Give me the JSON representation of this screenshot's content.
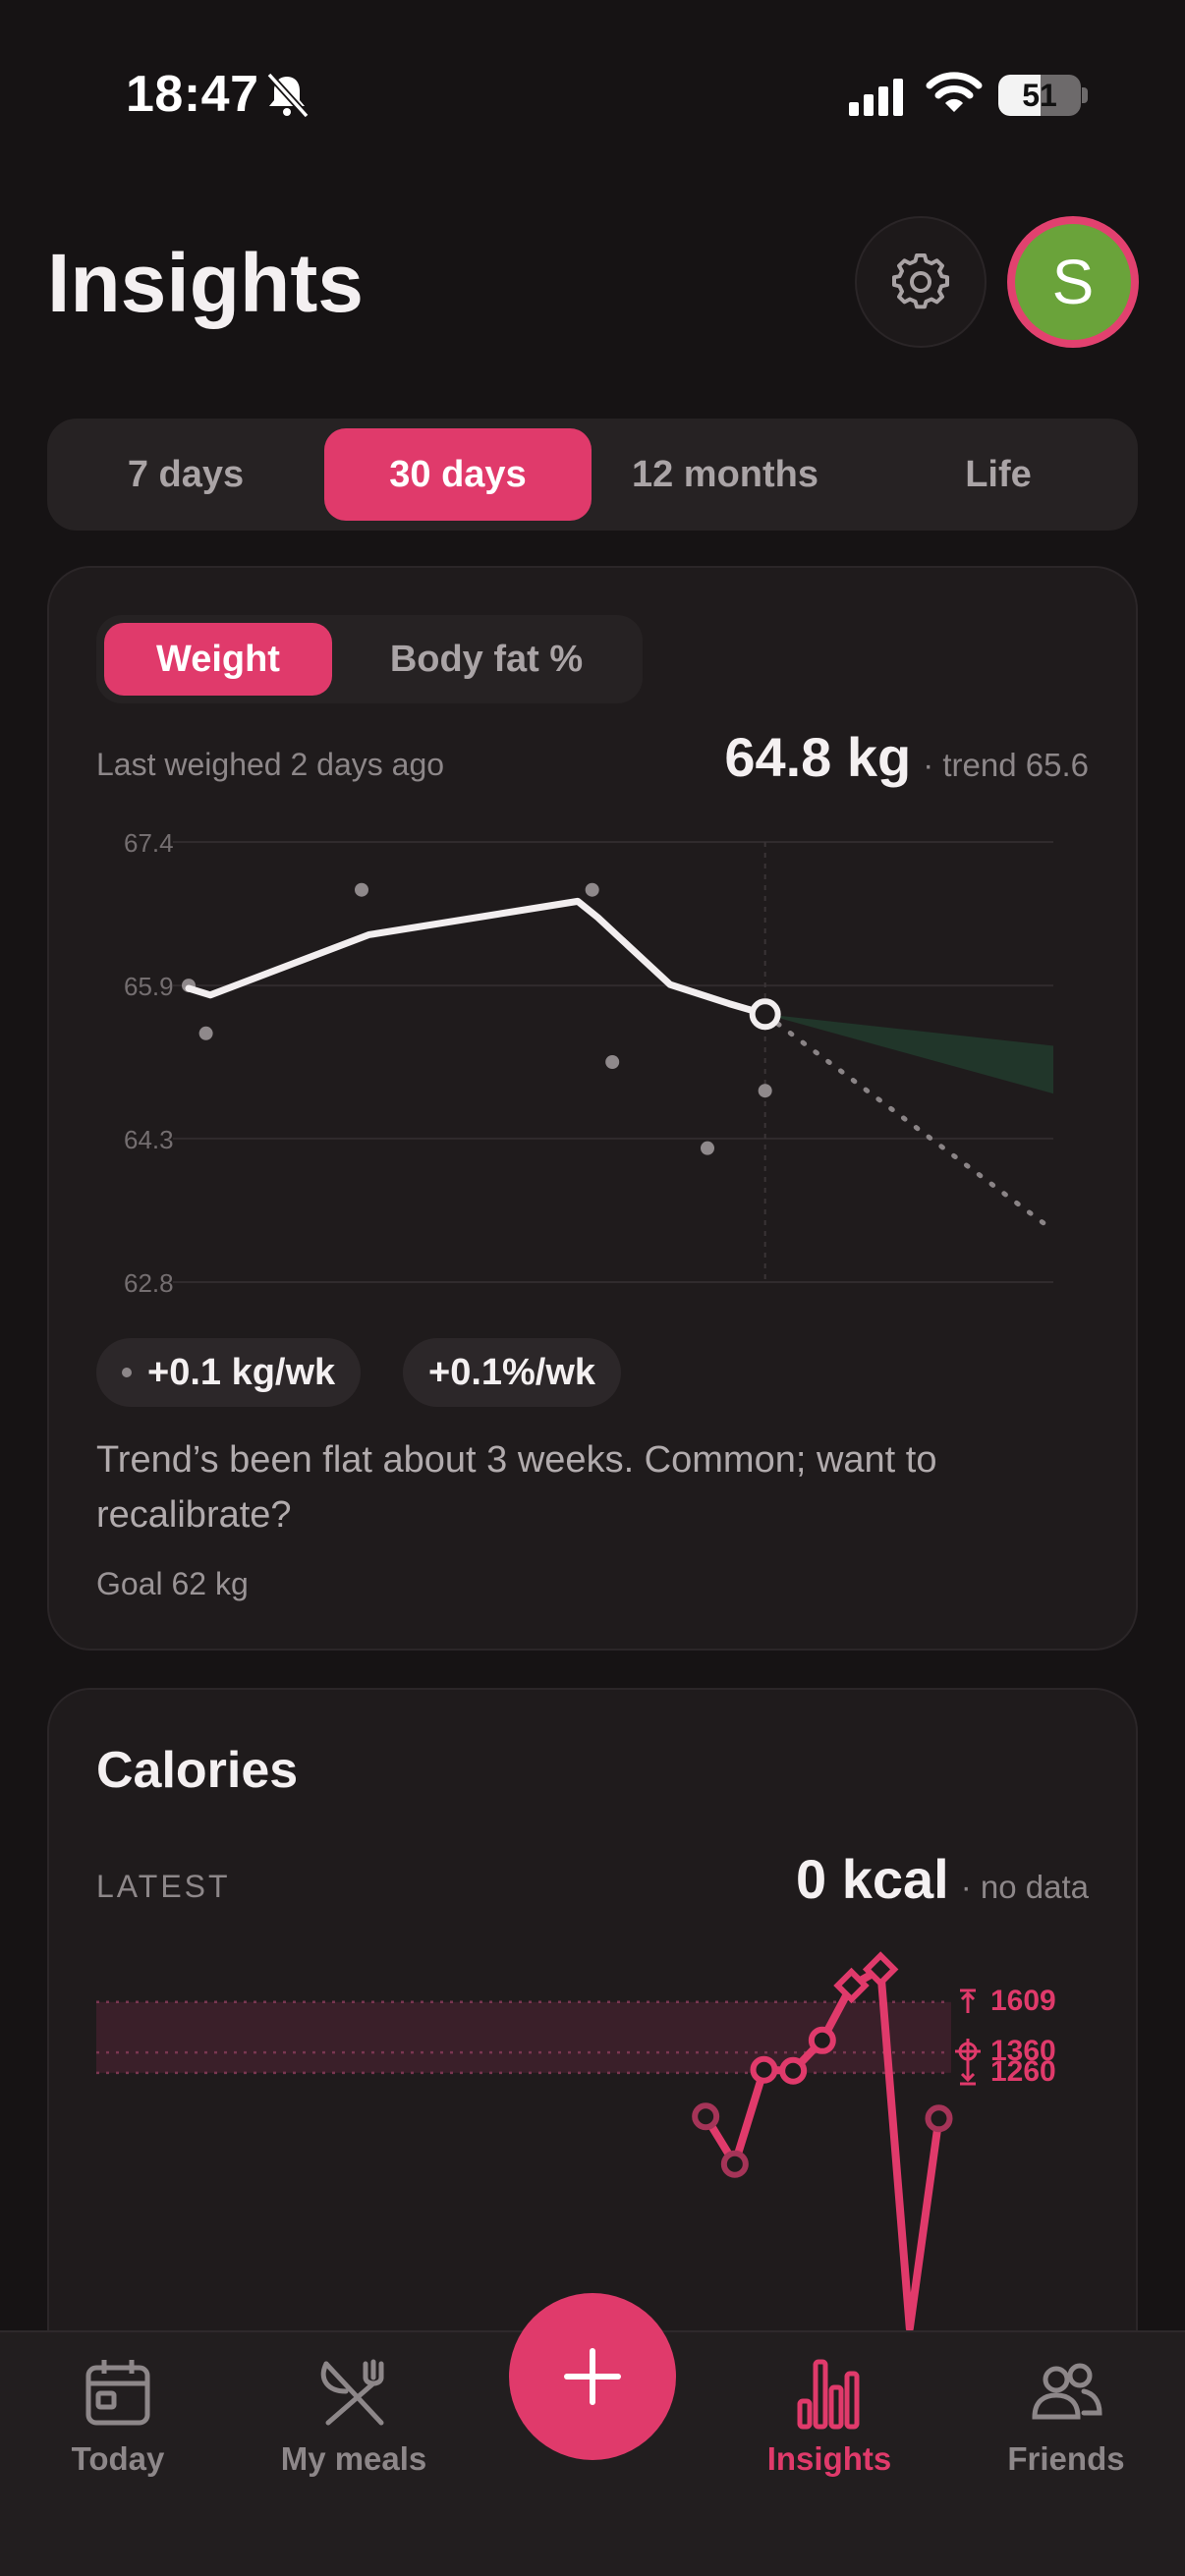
{
  "status_bar": {
    "time": "18:47",
    "battery": "51",
    "battery_level": 0.51
  },
  "header": {
    "title": "Insights",
    "avatar_initial": "S",
    "avatar_color": "#6aa33a",
    "accent": "#e03a6b"
  },
  "range_tabs": [
    {
      "label": "7 days",
      "active": false
    },
    {
      "label": "30 days",
      "active": true
    },
    {
      "label": "12 months",
      "active": false
    },
    {
      "label": "Life",
      "active": false
    }
  ],
  "weight_card": {
    "tabs": [
      {
        "label": "Weight",
        "active": true
      },
      {
        "label": "Body fat %",
        "active": false
      }
    ],
    "last_weighed": "Last weighed 2 days ago",
    "value": "64.8 kg",
    "trend": "· trend 65.6",
    "rate_kg": "+0.1 kg/wk",
    "rate_pct": "+0.1%/wk",
    "message": "Trend’s been flat about 3 weeks. Common; want to recalibrate?",
    "goal": "Goal 62 kg"
  },
  "calories_card": {
    "title": "Calories",
    "latest_label": "LATEST",
    "value": "0 kcal",
    "note": "· no data"
  },
  "bottom_nav": {
    "items": [
      {
        "label": "Today",
        "active": false
      },
      {
        "label": "My meals",
        "active": false
      },
      {
        "label": "Insights",
        "active": true
      },
      {
        "label": "Friends",
        "active": false
      }
    ],
    "fab_icon": "plus-icon"
  },
  "chart_data": [
    {
      "type": "line",
      "name": "weight",
      "ylim": [
        62.8,
        67.4
      ],
      "yticks": [
        "67.4",
        "65.9",
        "64.3",
        "62.8"
      ],
      "x_range": [
        0,
        30
      ],
      "today_x": 20,
      "points": [
        {
          "x": 0,
          "y": 65.9
        },
        {
          "x": 0.6,
          "y": 65.4
        },
        {
          "x": 6,
          "y": 66.9
        },
        {
          "x": 14,
          "y": 66.9
        },
        {
          "x": 14.7,
          "y": 65.1
        },
        {
          "x": 18,
          "y": 64.2
        },
        {
          "x": 20,
          "y": 64.8
        }
      ],
      "trend": [
        {
          "x": 0,
          "y": 65.87
        },
        {
          "x": 0.75,
          "y": 65.8
        },
        {
          "x": 6.25,
          "y": 66.43
        },
        {
          "x": 13.5,
          "y": 66.78
        },
        {
          "x": 14.2,
          "y": 66.61
        },
        {
          "x": 16.7,
          "y": 65.91
        },
        {
          "x": 18.75,
          "y": 65.71
        },
        {
          "x": 20,
          "y": 65.6
        }
      ],
      "projection_goal_line": [
        {
          "x": 20,
          "y": 65.6
        },
        {
          "x": 30,
          "y": 63.34
        }
      ],
      "projection_band": {
        "x": [
          20,
          30
        ],
        "upper": [
          65.6,
          65.27
        ],
        "lower": [
          65.6,
          64.77
        ]
      }
    },
    {
      "type": "line",
      "name": "calories",
      "reference_lines": [
        {
          "label": "1609",
          "value": 1609,
          "icon": "arrow-up-bar-icon"
        },
        {
          "label": "1360",
          "value": 1360,
          "icon": "target-icon"
        },
        {
          "label": "1260",
          "value": 1260,
          "icon": "arrow-down-bar-icon"
        }
      ],
      "band": [
        1260,
        1609
      ],
      "x_range": [
        0,
        30
      ],
      "ylim": [
        0,
        1850
      ],
      "points": [
        {
          "x": 20.5,
          "y": 1045,
          "marker": "circle-faded"
        },
        {
          "x": 21.5,
          "y": 810,
          "marker": "circle-faded"
        },
        {
          "x": 22.5,
          "y": 1275,
          "marker": "circle"
        },
        {
          "x": 23.5,
          "y": 1270,
          "marker": "circle"
        },
        {
          "x": 24.5,
          "y": 1420,
          "marker": "circle"
        },
        {
          "x": 25.5,
          "y": 1690,
          "marker": "diamond"
        },
        {
          "x": 26.5,
          "y": 1770,
          "marker": "diamond"
        },
        {
          "x": 27.5,
          "y": 0,
          "marker": "none"
        },
        {
          "x": 28.5,
          "y": 1035,
          "marker": "circle-faded"
        }
      ]
    }
  ]
}
